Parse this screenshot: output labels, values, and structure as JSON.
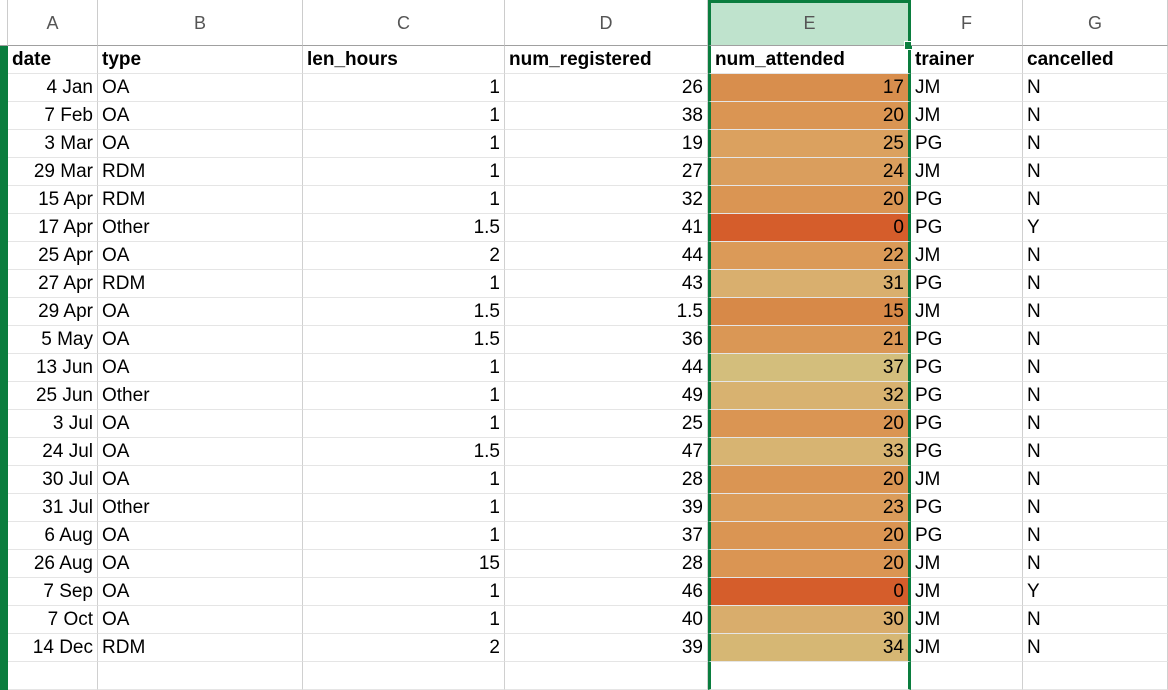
{
  "columns": {
    "A": "A",
    "B": "B",
    "C": "C",
    "D": "D",
    "E": "E",
    "F": "F",
    "G": "G"
  },
  "headers": {
    "date": "date",
    "type": "type",
    "len_hours": "len_hours",
    "num_registered": "num_registered",
    "num_attended": "num_attended",
    "trainer": "trainer",
    "cancelled": "cancelled"
  },
  "rows": [
    {
      "date": "4 Jan",
      "type": "OA",
      "len_hours": "1",
      "num_registered": "26",
      "num_attended": "17",
      "bg": "#d88e4d",
      "trainer": "JM",
      "cancelled": "N"
    },
    {
      "date": "7 Feb",
      "type": "OA",
      "len_hours": "1",
      "num_registered": "38",
      "num_attended": "20",
      "bg": "#da9553",
      "trainer": "JM",
      "cancelled": "N"
    },
    {
      "date": "3 Mar",
      "type": "OA",
      "len_hours": "1",
      "num_registered": "19",
      "num_attended": "25",
      "bg": "#dba15f",
      "trainer": "PG",
      "cancelled": "N"
    },
    {
      "date": "29 Mar",
      "type": "RDM",
      "len_hours": "1",
      "num_registered": "27",
      "num_attended": "24",
      "bg": "#da9e5d",
      "trainer": "JM",
      "cancelled": "N"
    },
    {
      "date": "15 Apr",
      "type": "RDM",
      "len_hours": "1",
      "num_registered": "32",
      "num_attended": "20",
      "bg": "#da9553",
      "trainer": "PG",
      "cancelled": "N"
    },
    {
      "date": "17 Apr",
      "type": "Other",
      "len_hours": "1.5",
      "num_registered": "41",
      "num_attended": "0",
      "bg": "#d55d2b",
      "trainer": "PG",
      "cancelled": "Y"
    },
    {
      "date": "25 Apr",
      "type": "OA",
      "len_hours": "2",
      "num_registered": "44",
      "num_attended": "22",
      "bg": "#db9a58",
      "trainer": "JM",
      "cancelled": "N"
    },
    {
      "date": "27 Apr",
      "type": "RDM",
      "len_hours": "1",
      "num_registered": "43",
      "num_attended": "31",
      "bg": "#d9af6e",
      "trainer": "PG",
      "cancelled": "N"
    },
    {
      "date": "29 Apr",
      "type": "OA",
      "len_hours": "1.5",
      "num_registered": "1.5",
      "num_attended": "15",
      "bg": "#d78948",
      "trainer": "JM",
      "cancelled": "N"
    },
    {
      "date": "5 May",
      "type": "OA",
      "len_hours": "1.5",
      "num_registered": "36",
      "num_attended": "21",
      "bg": "#da9755",
      "trainer": "PG",
      "cancelled": "N"
    },
    {
      "date": "13 Jun",
      "type": "OA",
      "len_hours": "1",
      "num_registered": "44",
      "num_attended": "37",
      "bg": "#d3be7c",
      "trainer": "PG",
      "cancelled": "N"
    },
    {
      "date": "25 Jun",
      "type": "Other",
      "len_hours": "1",
      "num_registered": "49",
      "num_attended": "32",
      "bg": "#d8b270",
      "trainer": "PG",
      "cancelled": "N"
    },
    {
      "date": "3 Jul",
      "type": "OA",
      "len_hours": "1",
      "num_registered": "25",
      "num_attended": "20",
      "bg": "#da9553",
      "trainer": "PG",
      "cancelled": "N"
    },
    {
      "date": "24 Jul",
      "type": "OA",
      "len_hours": "1.5",
      "num_registered": "47",
      "num_attended": "33",
      "bg": "#d7b472",
      "trainer": "PG",
      "cancelled": "N"
    },
    {
      "date": "30 Jul",
      "type": "OA",
      "len_hours": "1",
      "num_registered": "28",
      "num_attended": "20",
      "bg": "#da9553",
      "trainer": "JM",
      "cancelled": "N"
    },
    {
      "date": "31 Jul",
      "type": "Other",
      "len_hours": "1",
      "num_registered": "39",
      "num_attended": "23",
      "bg": "#db9c5a",
      "trainer": "PG",
      "cancelled": "N"
    },
    {
      "date": "6 Aug",
      "type": "OA",
      "len_hours": "1",
      "num_registered": "37",
      "num_attended": "20",
      "bg": "#da9553",
      "trainer": "PG",
      "cancelled": "N"
    },
    {
      "date": "26 Aug",
      "type": "OA",
      "len_hours": "15",
      "num_registered": "28",
      "num_attended": "20",
      "bg": "#da9553",
      "trainer": "JM",
      "cancelled": "N"
    },
    {
      "date": "7 Sep",
      "type": "OA",
      "len_hours": "1",
      "num_registered": "46",
      "num_attended": "0",
      "bg": "#d55d2b",
      "trainer": "JM",
      "cancelled": "Y"
    },
    {
      "date": "7 Oct",
      "type": "OA",
      "len_hours": "1",
      "num_registered": "40",
      "num_attended": "30",
      "bg": "#d9ad6c",
      "trainer": "JM",
      "cancelled": "N"
    },
    {
      "date": "14 Dec",
      "type": "RDM",
      "len_hours": "2",
      "num_registered": "39",
      "num_attended": "34",
      "bg": "#d6b774",
      "trainer": "JM",
      "cancelled": "N"
    }
  ]
}
